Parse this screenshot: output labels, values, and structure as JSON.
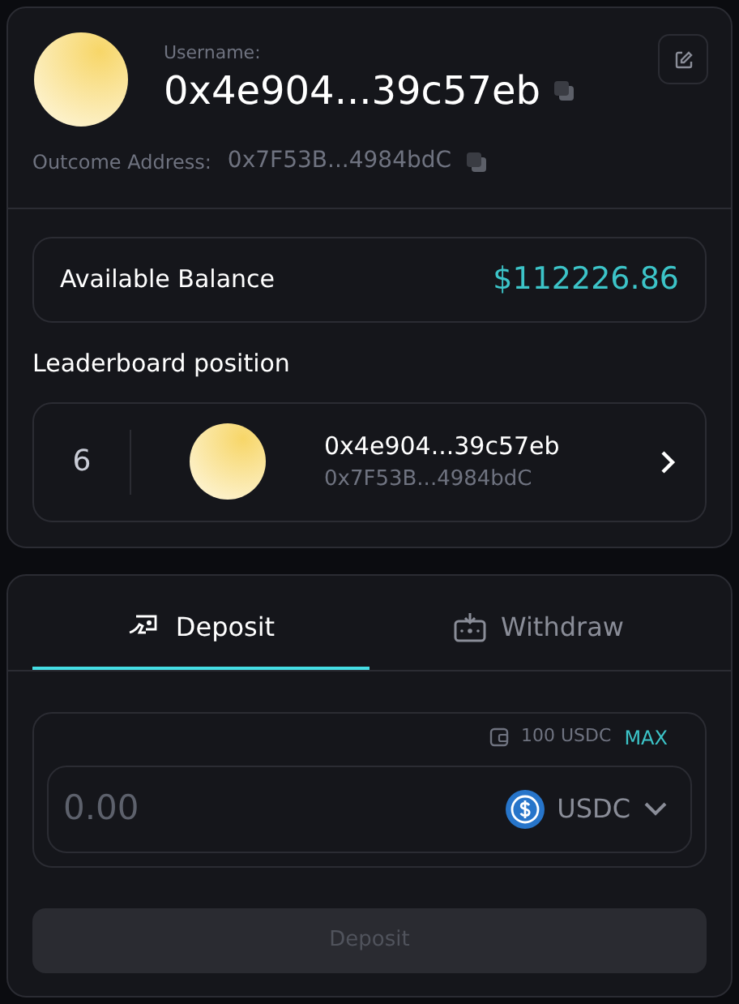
{
  "profile": {
    "username_label": "Username:",
    "username": "0x4e904...39c57eb",
    "outcome_label": "Outcome Address:",
    "outcome_address": "0x7F53B...4984bdC"
  },
  "balance": {
    "label": "Available Balance",
    "value": "$112226.86"
  },
  "leaderboard": {
    "title": "Leaderboard position",
    "rank": "6",
    "name": "0x4e904...39c57eb",
    "address": "0x7F53B...4984bdC"
  },
  "tabs": [
    {
      "label": "Deposit",
      "kind": "deposit",
      "selected": true
    },
    {
      "label": "Withdraw",
      "kind": "withdraw",
      "selected": false
    }
  ],
  "amount": {
    "wallet_balance": "100 USDC",
    "max_label": "MAX",
    "placeholder": "0.00",
    "token": "USDC"
  },
  "submit": {
    "label": "Deposit",
    "disabled": true
  }
}
